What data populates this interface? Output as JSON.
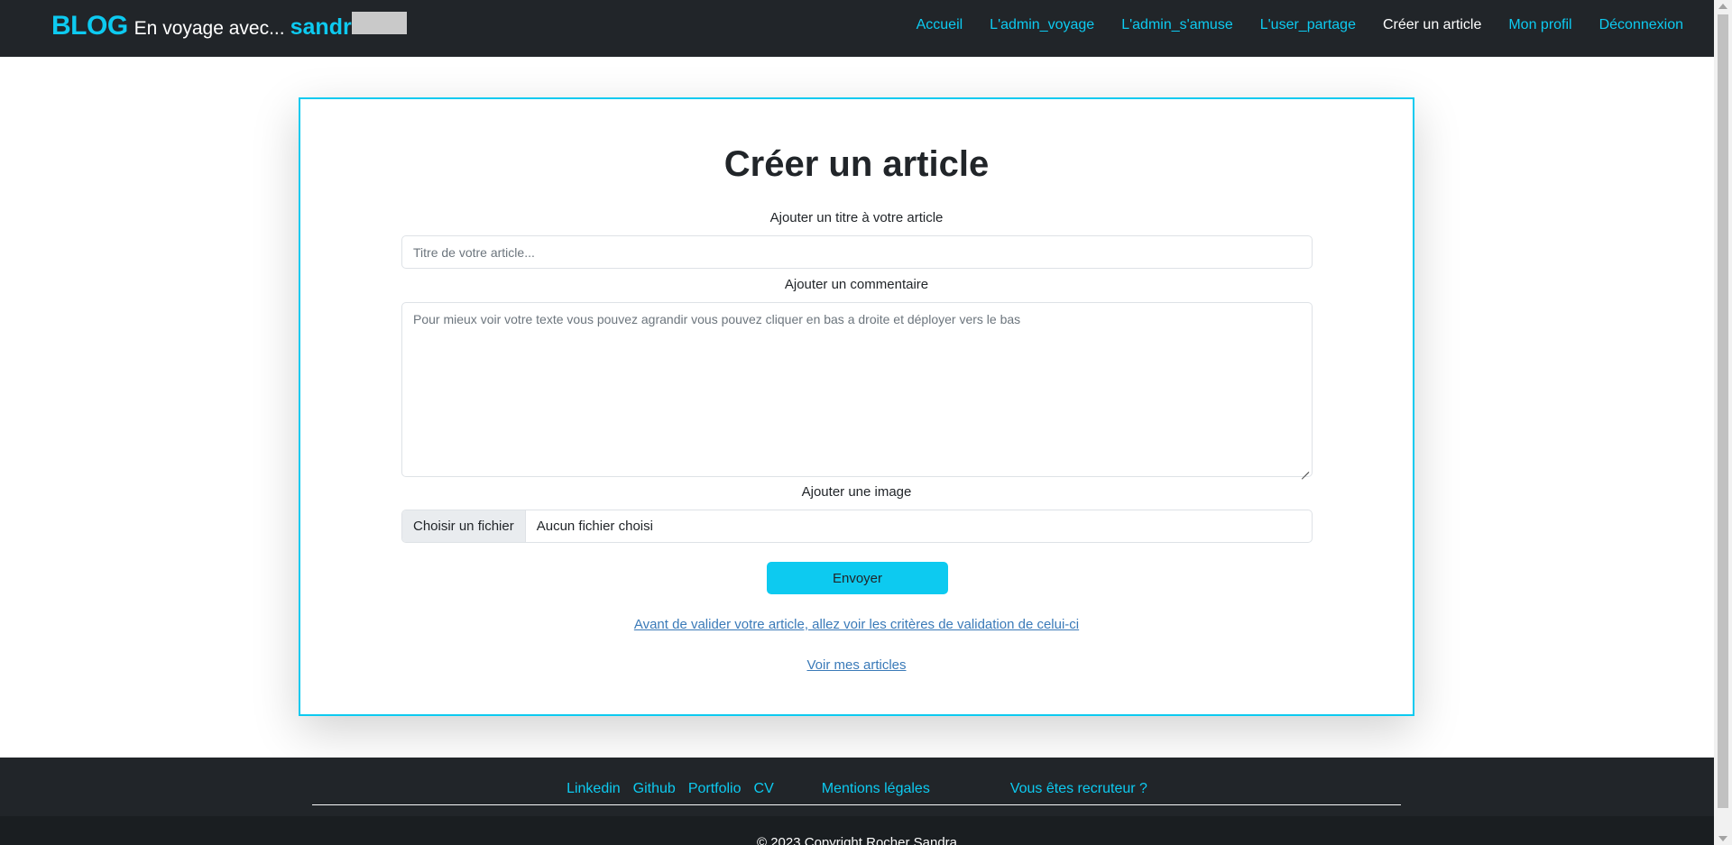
{
  "navbar": {
    "brand_blog": "BLOG",
    "brand_tagline": "En voyage avec...",
    "brand_user": "sandr",
    "links": [
      {
        "label": "Accueil",
        "active": false
      },
      {
        "label": "L'admin_voyage",
        "active": false
      },
      {
        "label": "L'admin_s'amuse",
        "active": false
      },
      {
        "label": "L'user_partage",
        "active": false
      },
      {
        "label": "Créer un article",
        "active": true
      },
      {
        "label": "Mon profil",
        "active": false
      },
      {
        "label": "Déconnexion",
        "active": false
      }
    ]
  },
  "form": {
    "title": "Créer un article",
    "title_label": "Ajouter un titre à votre article",
    "title_placeholder": "Titre de votre article...",
    "comment_label": "Ajouter un commentaire",
    "comment_placeholder": "Pour mieux voir votre texte vous pouvez agrandir vous pouvez cliquer en bas a droite et déployer vers le bas",
    "image_label": "Ajouter une image",
    "file_button": "Choisir un fichier",
    "file_status": "Aucun fichier choisi",
    "submit": "Envoyer",
    "criteria_link": "Avant de valider votre article, allez voir les critères de validation de celui-ci",
    "my_articles_link": "Voir mes articles"
  },
  "footer": {
    "links": {
      "linkedin": "Linkedin",
      "github": "Github",
      "portfolio": "Portfolio",
      "cv": "CV",
      "mentions": "Mentions légales",
      "recruiter": "Vous êtes recruteur ?"
    },
    "copyright": "© 2023 Copyright Rocher Sandra"
  },
  "colors": {
    "accent": "#0dcaf0",
    "navbar_bg": "#212529",
    "link": "#3a7ab8"
  }
}
